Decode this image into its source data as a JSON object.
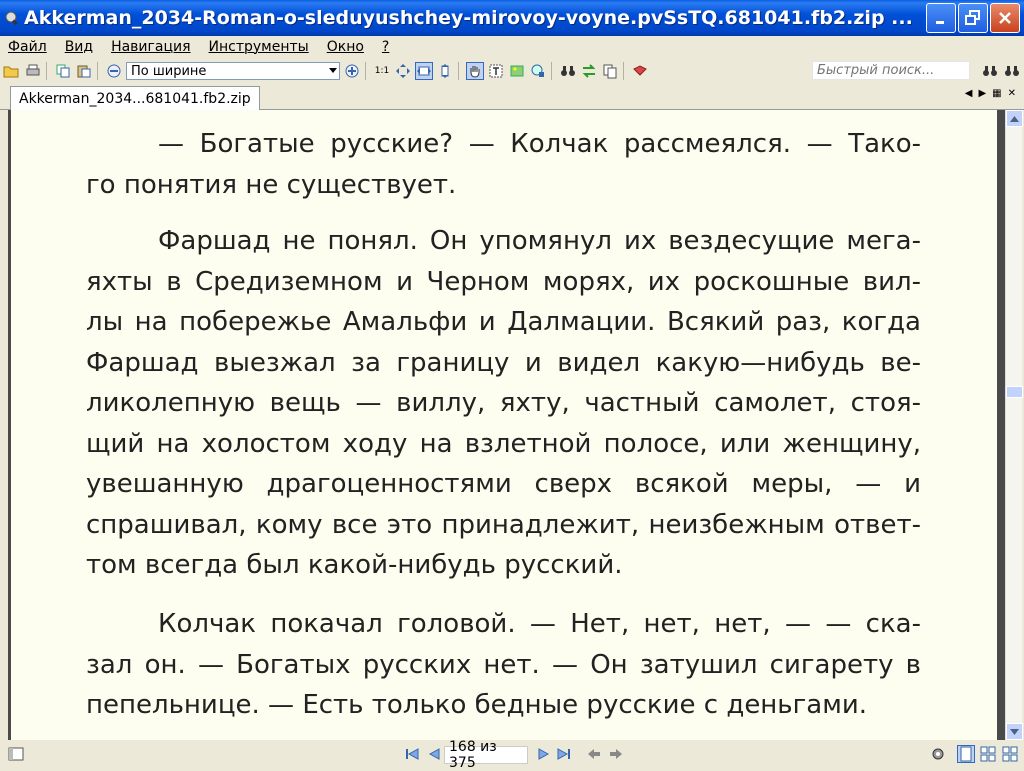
{
  "window": {
    "title": "Akkerman_2034-Roman-o-sleduyushchey-mirovoy-voyne.pvSsTQ.681041.fb2.zip ..."
  },
  "menu": [
    "Файл",
    "Вид",
    "Навигация",
    "Инструменты",
    "Окно",
    "?"
  ],
  "toolbar": {
    "zoom_value": "По ширине",
    "actual_size_label": "1:1",
    "search_placeholder": "Быстрый поиск..."
  },
  "tab": {
    "label": "Akkerman_2034...681041.fb2.zip"
  },
  "text": {
    "p1": [
      "— Богатые русские? — Колчак рассмеялся. — Тако-",
      "го понятия не существует."
    ],
    "p2": [
      "Фаршад не понял. Он упомянул их вездесущие мега-",
      "яхты в Средиземном и Черном морях, их роскошные вил-",
      "лы на побережье Амальфи и Далмации. Всякий раз, когда",
      "Фаршад выезжал за границу и видел какую—нибудь ве-",
      "ликолепную вещь — виллу, яхту, частный самолет, стоя-",
      "щий на холостом ходу на взлетной полосе, или женщину,",
      "увешанную драгоценностями сверх всякой меры, — и",
      "спрашивал, кому все это принадлежит, неизбежным ответ-",
      "том всегда был какой-нибудь русский."
    ],
    "p3": [
      "Колчак покачал головой. — Нет, нет, нет, — — ска-",
      "зал он. — Богатых русских нет. — Он затушил сигарету в",
      "пепельнице. — Есть только бедные русские с деньгами."
    ]
  },
  "status": {
    "page_indicator": "168 из 375"
  },
  "colors": {
    "titlebar": "#0050D8",
    "page_background": "#FEFEF0",
    "chrome": "#ECE9D8"
  }
}
